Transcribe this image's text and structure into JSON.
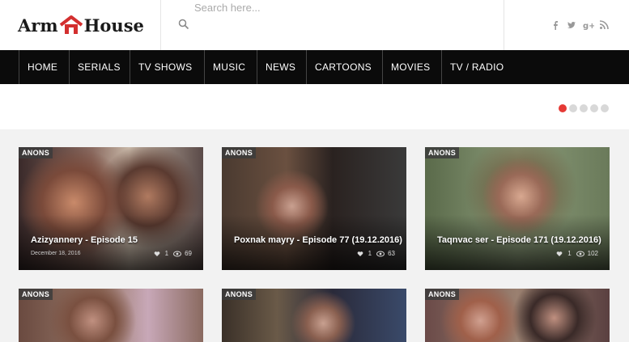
{
  "logo": {
    "part1": "Arm",
    "part2": "House"
  },
  "search": {
    "placeholder": "Search here..."
  },
  "social": [
    "facebook-icon",
    "twitter-icon",
    "google-plus-icon",
    "rss-icon"
  ],
  "nav": {
    "items": [
      "HOME",
      "SERIALS",
      "TV SHOWS",
      "MUSIC",
      "NEWS",
      "CARTOONS",
      "MOVIES",
      "TV / RADIO"
    ]
  },
  "slider": {
    "dots": 5,
    "active": 0,
    "accent": "#e53935"
  },
  "cards": [
    {
      "badge": "ANONS",
      "title": "Azizyannery - Episode 15",
      "date": "December 18, 2016",
      "likes": "1",
      "views": "69"
    },
    {
      "badge": "ANONS",
      "title": "Poxnak mayry - Episode 77 (19.12.2016)",
      "date": "",
      "likes": "1",
      "views": "63"
    },
    {
      "badge": "ANONS",
      "title": "Taqnvac ser - Episode 171 (19.12.2016)",
      "date": "",
      "likes": "1",
      "views": "102"
    },
    {
      "badge": "ANONS"
    },
    {
      "badge": "ANONS"
    },
    {
      "badge": "ANONS"
    }
  ]
}
